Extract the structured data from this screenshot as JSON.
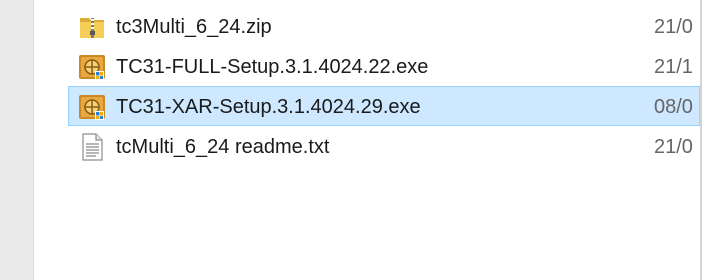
{
  "files": [
    {
      "name": "tc3Multi_6_24.zip",
      "date": "21/0",
      "icon": "zip-folder-icon",
      "selected": false
    },
    {
      "name": "TC31-FULL-Setup.3.1.4024.22.exe",
      "date": "21/1",
      "icon": "installer-icon",
      "selected": false
    },
    {
      "name": "TC31-XAR-Setup.3.1.4024.29.exe",
      "date": "08/0",
      "icon": "installer-icon",
      "selected": true
    },
    {
      "name": "tcMulti_6_24 readme.txt",
      "date": "21/0",
      "icon": "text-file-icon",
      "selected": false
    }
  ],
  "colors": {
    "selection_fill": "#cde8ff",
    "selection_border": "#99d1ff",
    "nav_background": "#e9e9e9"
  }
}
